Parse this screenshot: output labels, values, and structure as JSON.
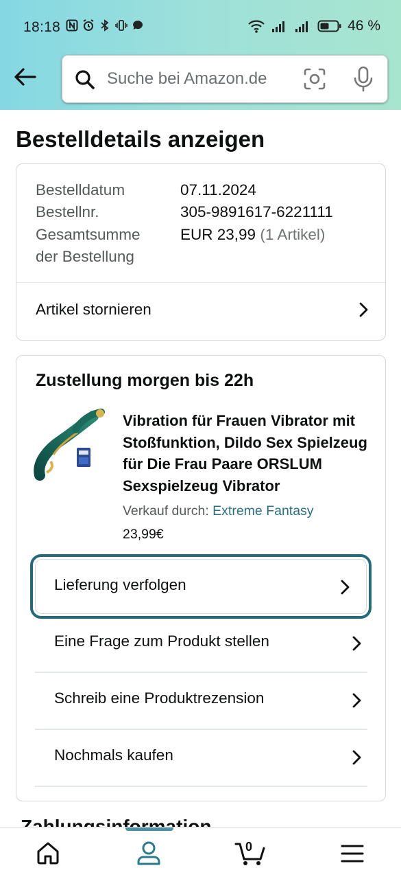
{
  "status_bar": {
    "time": "18:18",
    "battery": "46 %"
  },
  "search": {
    "placeholder": "Suche bei Amazon.de"
  },
  "page_title": "Bestelldetails anzeigen",
  "order_summary": {
    "rows": [
      {
        "label": "Bestelldatum",
        "value": "07.11.2024"
      },
      {
        "label": "Bestellnr.",
        "value": "305-9891617-6221111"
      },
      {
        "label": "Gesamtsumme",
        "value": "EUR 23,99",
        "value_extra": "(1 Artikel)"
      },
      {
        "label": "der Bestellung"
      }
    ],
    "cancel_link": "Artikel stornieren"
  },
  "delivery": {
    "heading": "Zustellung morgen bis 22h",
    "product": {
      "title": "Vibration für Frauen Vibrator mit Stoßfunktion, Dildo Sex Spielzeug für Die Frau Paare ORSLUM Sexspielzeug Vibrator",
      "sold_by_label": "Verkauf durch:",
      "seller": "Extreme Fantasy",
      "price": "23,99€"
    },
    "actions": [
      {
        "label": "Lieferung verfolgen"
      },
      {
        "label": "Eine Frage zum Produkt stellen"
      },
      {
        "label": "Schreib eine Produktrezension"
      },
      {
        "label": "Nochmals kaufen"
      }
    ]
  },
  "next_section_title": "Zahlungsinformation",
  "bottom_nav": {
    "cart_count": "0",
    "active": "account"
  },
  "colors": {
    "header_gradient_start": "#84d8e3",
    "header_gradient_end": "#a8e5cf",
    "link_teal": "#2a6f86",
    "focus_ring": "#236a7a",
    "nav_indicator": "#4b8fa3"
  },
  "icons": [
    "back-arrow-icon",
    "search-icon",
    "camera-icon",
    "mic-icon",
    "chevron-right-icon",
    "home-icon",
    "account-icon",
    "cart-icon",
    "menu-icon"
  ]
}
